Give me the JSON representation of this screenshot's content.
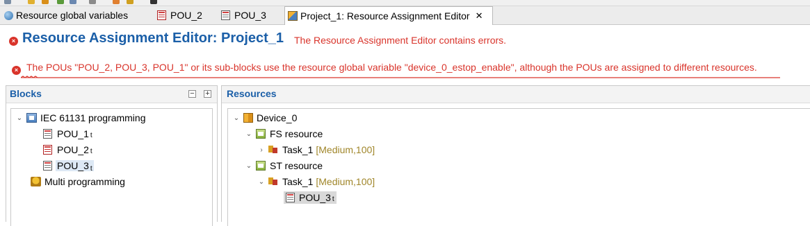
{
  "tabs": [
    {
      "label": "Resource global variables",
      "icon": "globe-icon",
      "active": false
    },
    {
      "label": "POU_2",
      "icon": "pou-icon",
      "active": false
    },
    {
      "label": "POU_3",
      "icon": "pou-icon",
      "active": false
    },
    {
      "label": "Project_1: Resource Assignment Editor",
      "icon": "project-icon",
      "active": true,
      "close": "✕"
    }
  ],
  "editor": {
    "title": "Resource Assignment Editor: Project_1",
    "error_summary": "The Resource Assignment Editor contains errors.",
    "error_message": "The POUs \"POU_2, POU_3, POU_1\" or its sub-blocks use the resource global variable \"device_0_estop_enable\", although the POUs are assigned to different resources.",
    "error_icon": "×"
  },
  "blocks": {
    "title": "Blocks",
    "collapse_all": "−",
    "expand_all": "+",
    "tree": [
      {
        "label": "IEC 61131 programming",
        "expanded": true,
        "icon": "program-folder-icon",
        "children": [
          {
            "label": "POU_1",
            "suffix": "t",
            "icon": "pou-icon"
          },
          {
            "label": "POU_2",
            "suffix": "t",
            "icon": "pou-error-icon"
          },
          {
            "label": "POU_3",
            "suffix": "t",
            "icon": "pou-icon",
            "selected": true
          }
        ]
      },
      {
        "label": "Multi programming",
        "icon": "multi-programming-icon"
      }
    ]
  },
  "resources": {
    "title": "Resources",
    "tree": {
      "device": "Device_0",
      "resources": [
        {
          "label": "FS resource",
          "expanded": true,
          "tasks": [
            {
              "label": "Task_1",
              "detail": "[Medium,100]",
              "expanded": false
            }
          ]
        },
        {
          "label": "ST resource",
          "expanded": true,
          "tasks": [
            {
              "label": "Task_1",
              "detail": "[Medium,100]",
              "expanded": true,
              "pous": [
                {
                  "label": "POU_3",
                  "suffix": "t"
                }
              ]
            }
          ]
        }
      ]
    }
  },
  "colors": {
    "accent_blue": "#1b5fa8",
    "error_red": "#d9342b",
    "detail_gold": "#a0862a"
  }
}
